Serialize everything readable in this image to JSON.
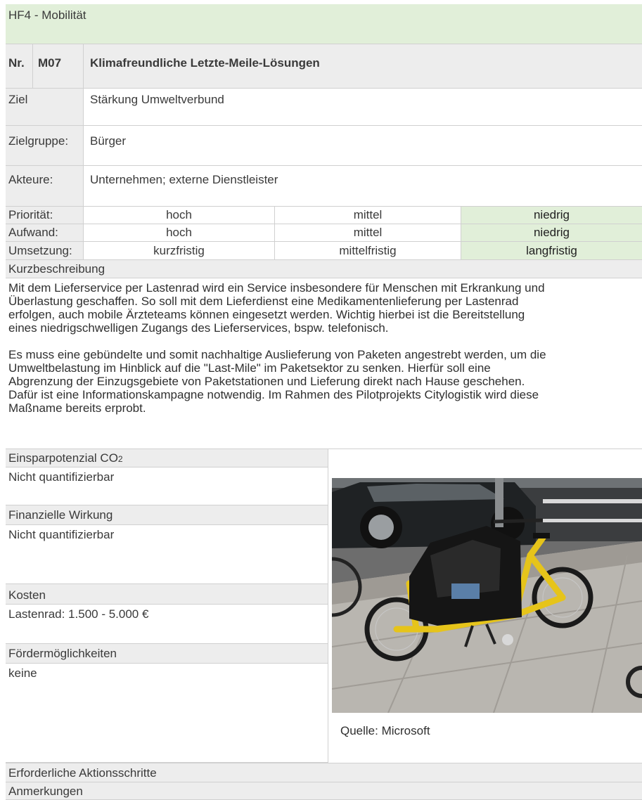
{
  "header": {
    "title": "HF4 - Mobilität"
  },
  "measure": {
    "nr_label": "Nr.",
    "nr": "M07",
    "title": "Klimafreundliche Letzte-Meile-Lösungen"
  },
  "fields": {
    "ziel_label": "Ziel",
    "ziel": "Stärkung Umweltverbund",
    "zielgruppe_label": "Zielgruppe:",
    "zielgruppe": "Bürger",
    "akteure_label": "Akteure:",
    "akteure": "Unternehmen; externe Dienstleister"
  },
  "ratings": [
    {
      "label": "Priorität:",
      "options": [
        "hoch",
        "mittel",
        "niedrig"
      ],
      "selected": 2
    },
    {
      "label": "Aufwand:",
      "options": [
        "hoch",
        "mittel",
        "niedrig"
      ],
      "selected": 2
    },
    {
      "label": "Umsetzung:",
      "options": [
        "kurzfristig",
        "mittelfristig",
        "langfristig"
      ],
      "selected": 2
    }
  ],
  "kurzbeschreibung": {
    "label": "Kurzbeschreibung",
    "text": "Mit dem Lieferservice per Lastenrad wird ein Service insbesondere für Menschen mit Erkrankung und\nÜberlastung geschaffen. So soll mit dem Lieferdienst eine Medikamentenlieferung per Lastenrad\nerfolgen, auch mobile Ärzteteams können eingesetzt werden. Wichtig hierbei ist die Bereitstellung\neines niedrigschwelligen Zugangs des Lieferservices, bspw. telefonisch.\n\nEs muss eine gebündelte und somit nachhaltige Auslieferung von Paketen angestrebt werden, um die\nUmweltbelastung im Hinblick auf die \"Last-Mile\" im Paketsektor zu senken. Hierfür soll eine\nAbgrenzung der Einzugsgebiete von Paketstationen und Lieferung direkt nach Hause geschehen.\nDafür ist eine Informationskampagne notwendig. Im Rahmen des Pilotprojekts Citylogistik wird diese\nMaßname bereits erprobt."
  },
  "left_sections": {
    "co2_label": "Einsparpotenzial CO",
    "co2_sub": "2",
    "co2_value": "Nicht quantifizierbar",
    "finanz_label": "Finanzielle Wirkung",
    "finanz_value": "Nicht quantifizierbar",
    "kosten_label": "Kosten",
    "kosten_value": "Lastenrad: 1.500 - 5.000 €",
    "foerder_label": "Fördermöglichkeiten",
    "foerder_value": "keine"
  },
  "image": {
    "caption": "Quelle: Microsoft"
  },
  "footer": {
    "aktionsschritte_label": "Erforderliche Aktionsschritte",
    "anmerkungen_label": "Anmerkungen"
  },
  "colors": {
    "header_green": "#e1efd9",
    "label_gray": "#ededed",
    "border": "#d0d0d0"
  }
}
